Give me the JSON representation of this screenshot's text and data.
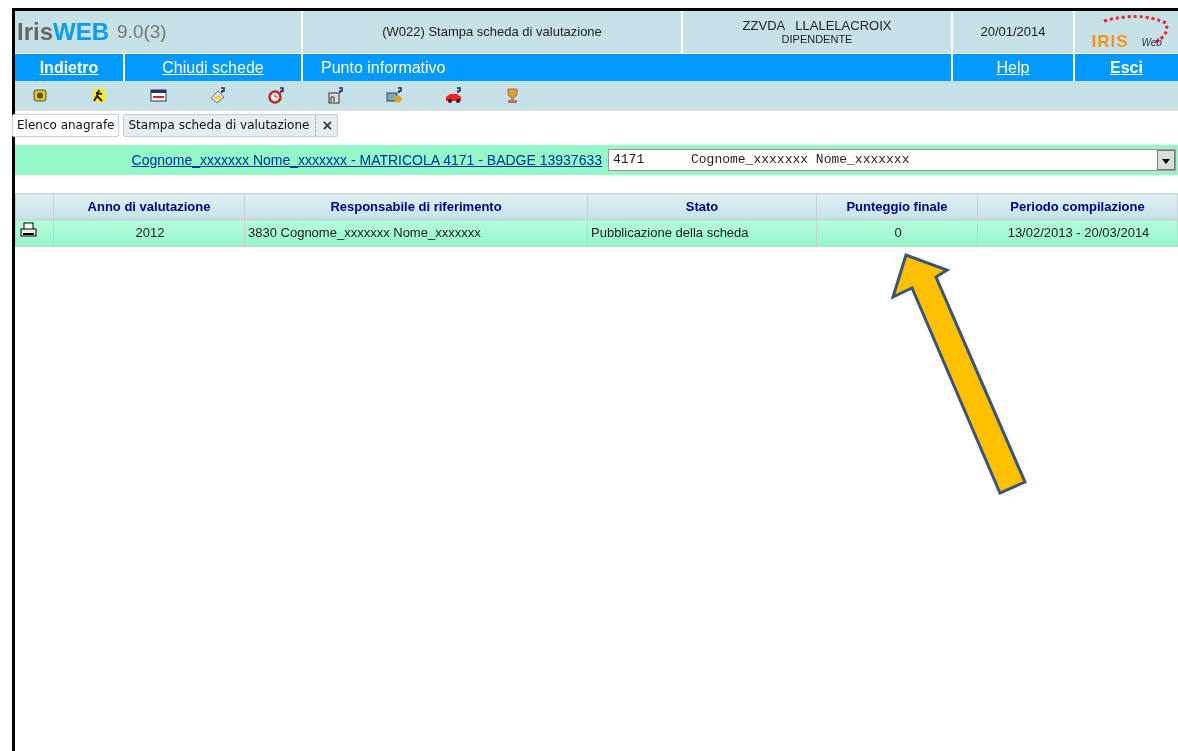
{
  "header": {
    "app_name": "Iris",
    "app_name_accent": "WEB",
    "version": "9.0(3)",
    "page_title": "(W022) Stampa scheda di valutazione",
    "user": "ZZVDA   LLALELACROIX",
    "role": "DIPENDENTE",
    "date": "20/01/2014",
    "logo_text": "IRIS",
    "logo_sub": "Web"
  },
  "nav": [
    {
      "label": "Indietro",
      "bold": true
    },
    {
      "label": "Chiudi schede",
      "bold": false
    },
    {
      "label": "Punto informativo",
      "bold": false,
      "plain": true
    },
    {
      "label": "Help",
      "bold": false
    },
    {
      "label": "Esci",
      "bold": true
    }
  ],
  "tabs": [
    {
      "label": "Elenco anagrafe",
      "selected": false,
      "closable": false
    },
    {
      "label": "Stampa scheda di valutazione",
      "selected": true,
      "closable": true,
      "close": "×"
    }
  ],
  "employee": {
    "link": "Cognome_xxxxxxx Nome_xxxxxxx - MATRICOLA 4171 - BADGE 13937633",
    "select_value": "4171      Cognome_xxxxxxx Nome_xxxxxxx"
  },
  "table": {
    "columns": [
      "Anno di valutazione",
      "Responsabile di riferimento",
      "Stato",
      "Punteggio finale",
      "Periodo compilazione"
    ],
    "rows": [
      {
        "cells": [
          "2012",
          "3830 Cognome_xxxxxxx Nome_xxxxxxx",
          "Pubblicazione della scheda",
          "0",
          "13/02/2013 - 20/03/2014"
        ]
      }
    ]
  }
}
